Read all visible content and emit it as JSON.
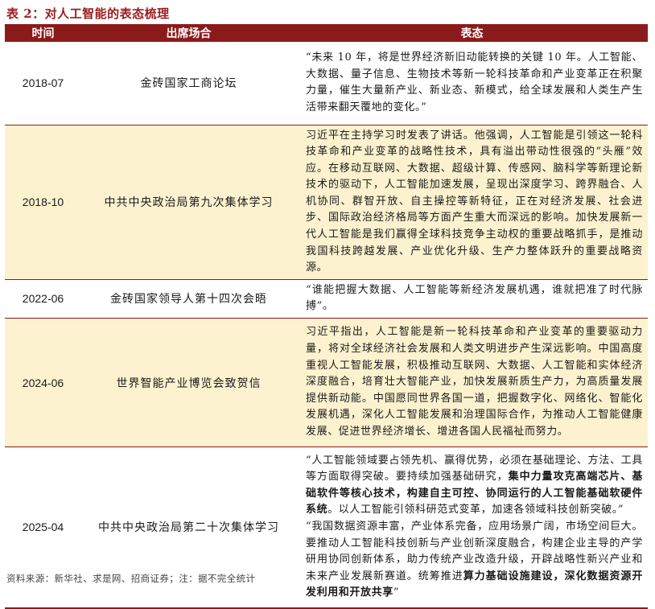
{
  "caption": "表 2：对人工智能的表态梳理",
  "headers": {
    "time": "时间",
    "venue": "出席场合",
    "statement": "表态"
  },
  "rows": [
    {
      "time": "2018-07",
      "venue": "金砖国家工商论坛",
      "statement": "“未来 10 年，将是世界经济新旧动能转换的关键 10 年。人工智能、大数据、量子信息、生物技术等新一轮科技革命和产业变革正在积聚力量，催生大量新产业、新业态、新模式，给全球发展和人类生产生活带来翻天覆地的变化。”"
    },
    {
      "time": "2018-10",
      "venue": "中共中央政治局第九次集体学习",
      "statement": "习近平在主持学习时发表了讲话。他强调，人工智能是引领这一轮科技革命和产业变革的战略性技术，具有溢出带动性很强的“头雁”效应。在移动互联网、大数据、超级计算、传感网、脑科学等新理论新技术的驱动下，人工智能加速发展，呈现出深度学习、跨界融合、人机协同、群智开放、自主操控等新特征，正在对经济发展、社会进步、国际政治经济格局等方面产生重大而深远的影响。加快发展新一代人工智能是我们赢得全球科技竞争主动权的重要战略抓手，是推动我国科技跨越发展、产业优化升级、生产力整体跃升的重要战略资源。"
    },
    {
      "time": "2022-06",
      "venue": "金砖国家领导人第十四次会晤",
      "statement": "“谁能把握大数据、人工智能等新经济发展机遇，谁就把准了时代脉搏”。"
    },
    {
      "time": "2024-06",
      "venue": "世界智能产业博览会致贺信",
      "statement": "习近平指出，人工智能是新一轮科技革命和产业变革的重要驱动力量，将对全球经济社会发展和人类文明进步产生深远影响。中国高度重视人工智能发展，积极推动互联网、大数据、人工智能和实体经济深度融合，培育壮大智能产业，加快发展新质生产力，为高质量发展提供新动能。中国愿同世界各国一道，把握数字化、网络化、智能化发展机遇，深化人工智能发展和治理国际合作，为推动人工智能健康发展、促进世界经济增长、增进各国人民福祉而努力。"
    },
    {
      "time": "2025-04",
      "venue": "中共中央政治局第二十次集体学习",
      "p1a": "“人工智能领域要占领先机、赢得优势，必须在基础理论、方法、工具等方面取得突破。要持续加强基础研究，",
      "p1b": "集中力量攻克高端芯片、基础软件等核心技术，构建自主可控、协同运行的人工智能基础软硬件系统",
      "p1c": "。以人工智能引领科研范式变革，加速各领域科技创新突破。”",
      "p2a": "“我国数据资源丰富，产业体系完备，应用场景广阔，市场空间巨大。要推动人工智能科技创新与产业创新深度融合，构建企业主导的产学研用协同创新体系，助力传统产业改造升级，开辟战略性新兴产业和未来产业发展新赛道。统筹推进",
      "p2b": "算力基础设施建设，深化数据资源开发利用和开放共享",
      "p2c": "”"
    }
  ],
  "source": "资料来源：新华社、求是网、招商证券；注：据不完全统计"
}
